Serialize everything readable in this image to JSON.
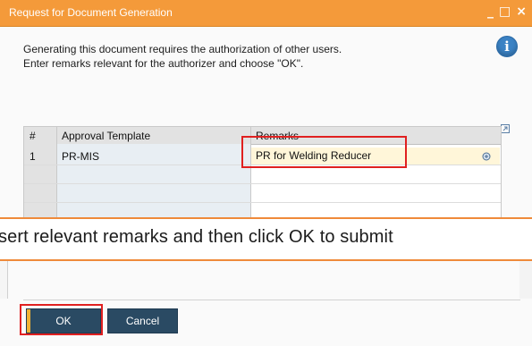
{
  "window": {
    "title": "Request for Document Generation",
    "controls": [
      "_",
      "□",
      "×"
    ]
  },
  "message": {
    "line1": "Generating this document requires the authorization of other users.",
    "line2": "Enter remarks relevant for the authorizer and choose \"OK\"."
  },
  "info_icon_glyph": "i",
  "grid": {
    "headers": [
      "#",
      "Approval Template",
      "Remarks"
    ],
    "rows": [
      {
        "num": "1",
        "template": "PR-MIS",
        "remarks": "PR for Welding Reducer"
      }
    ]
  },
  "banner": {
    "text": "sert relevant remarks and then click OK to submit"
  },
  "buttons": {
    "ok": "OK",
    "cancel": "Cancel"
  },
  "colors": {
    "titlebar": "#f49a3a",
    "highlight": "#e02020",
    "button": "#2a4a63",
    "accent_bar": "#f2b233"
  }
}
